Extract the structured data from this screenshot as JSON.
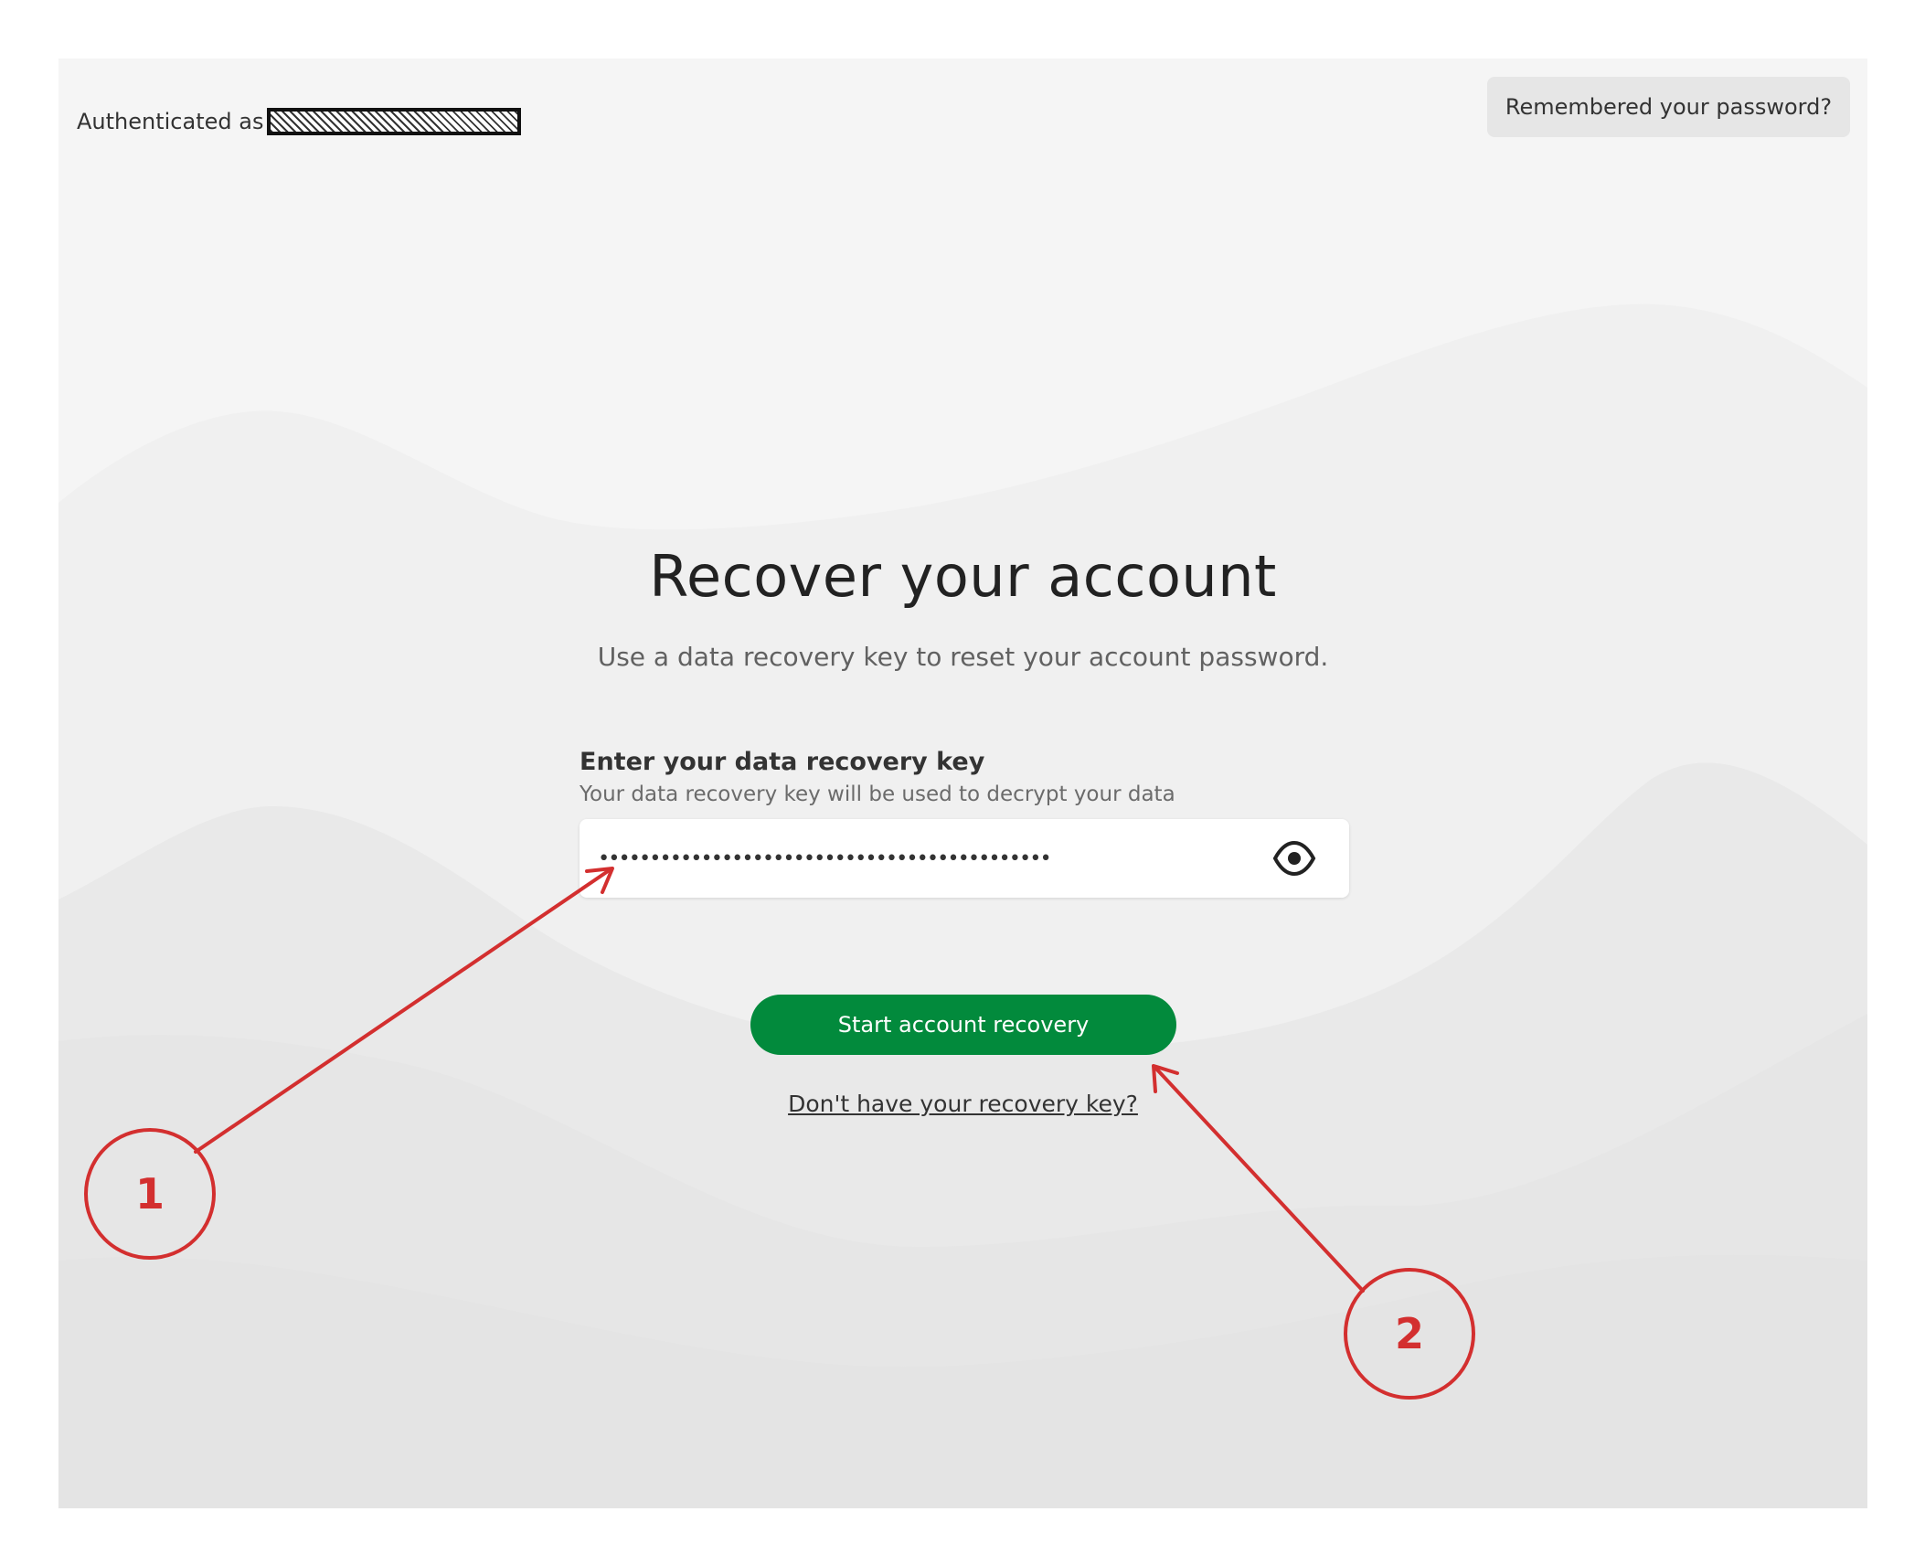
{
  "header": {
    "authenticated_prefix": "Authenticated as",
    "remember_button_label": "Remembered your password?"
  },
  "main": {
    "title": "Recover your account",
    "subtitle": "Use a data recovery key to reset your account password."
  },
  "recovery_key_field": {
    "label": "Enter your data recovery key",
    "help_text": "Your data recovery key will be used to decrypt your data",
    "masked_value": "••••••••••••••••••••••••••••••••••••••••••••"
  },
  "actions": {
    "start_button_label": "Start account recovery",
    "no_key_link_label": "Don't have your recovery key?"
  },
  "annotations": {
    "marker_1": "1",
    "marker_2": "2",
    "color": "#d32f2f"
  },
  "colors": {
    "primary_green": "#028a3c",
    "background": "#f5f5f5"
  },
  "icons": {
    "reveal": "eye-icon"
  }
}
